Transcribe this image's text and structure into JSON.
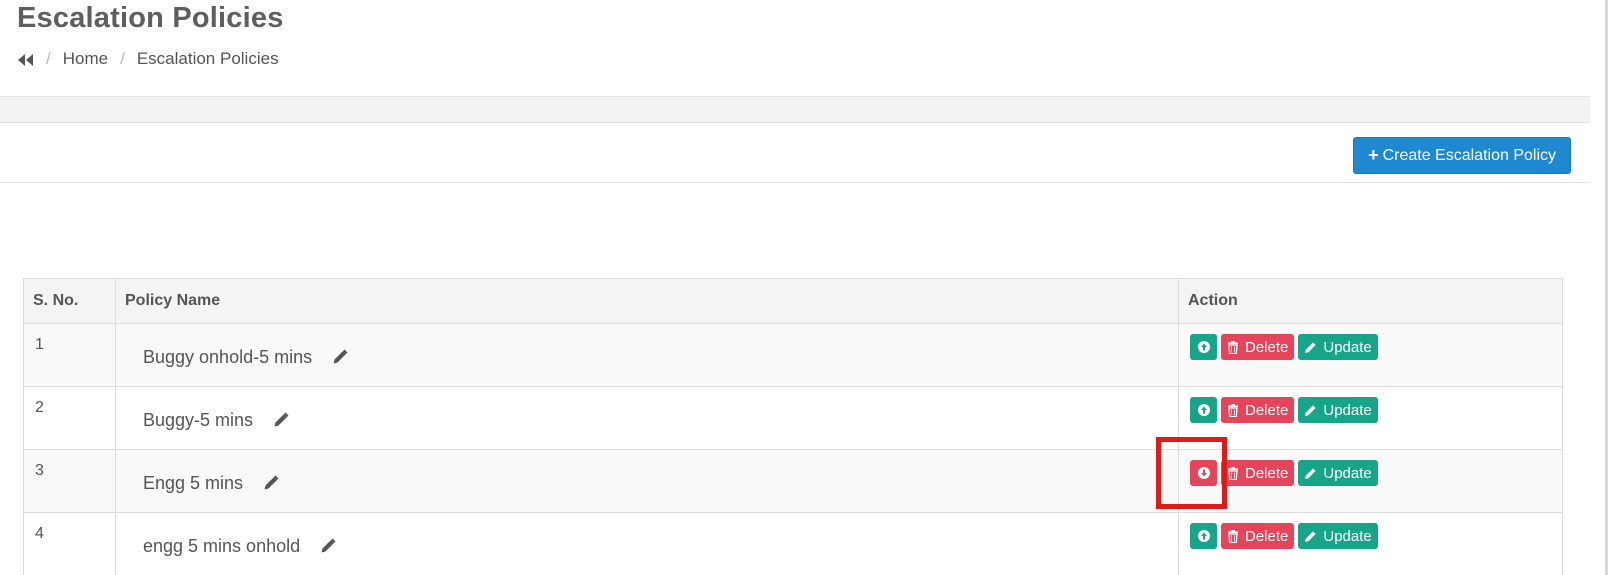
{
  "header": {
    "title": "Escalation Policies",
    "breadcrumb": {
      "home": "Home",
      "current": "Escalation Policies"
    }
  },
  "toolbar": {
    "create_label": "Create Escalation Policy"
  },
  "table": {
    "columns": [
      "S. No.",
      "Policy Name",
      "Action"
    ],
    "rows": [
      {
        "sno": "1",
        "name": "Buggy onhold-5 mins",
        "move": "up"
      },
      {
        "sno": "2",
        "name": "Buggy-5 mins",
        "move": "up"
      },
      {
        "sno": "3",
        "name": "Engg 5 mins",
        "move": "down"
      },
      {
        "sno": "4",
        "name": "engg 5 mins onhold",
        "move": "up"
      }
    ],
    "delete_label": "Delete",
    "update_label": "Update"
  },
  "colors": {
    "primary": "#1e88d0",
    "success": "#17a589",
    "danger": "#e5455b",
    "highlight": "#e01919"
  },
  "icons": {
    "back": "double-chevron-left-icon",
    "move_up": "circle-arrow-up-icon",
    "move_down": "circle-arrow-down-icon",
    "delete": "trash-icon",
    "update": "pencil-icon",
    "create": "plus-icon"
  }
}
